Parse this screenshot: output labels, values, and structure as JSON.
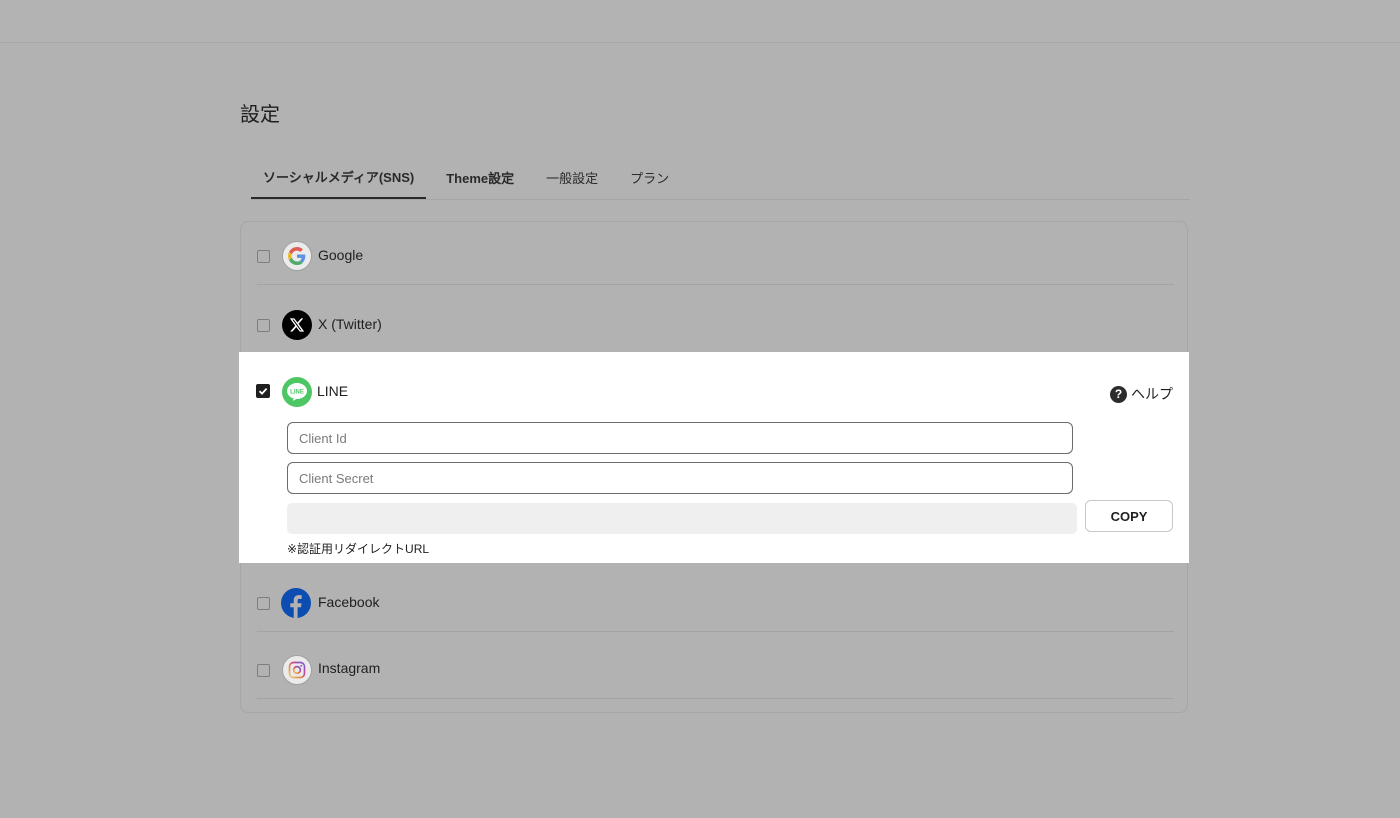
{
  "page": {
    "title": "設定"
  },
  "tabs": [
    {
      "label": "ソーシャルメディア(SNS)",
      "active": true
    },
    {
      "label": "Theme設定",
      "active": false
    },
    {
      "label": "一般設定",
      "active": false
    },
    {
      "label": "プラン",
      "active": false
    }
  ],
  "providers": {
    "google": {
      "label": "Google",
      "checked": false,
      "icon": "google-icon"
    },
    "twitter": {
      "label": "X (Twitter)",
      "checked": false,
      "icon": "x-icon"
    },
    "line": {
      "label": "LINE",
      "checked": true,
      "icon": "line-icon"
    },
    "facebook": {
      "label": "Facebook",
      "checked": false,
      "icon": "facebook-icon"
    },
    "instagram": {
      "label": "Instagram",
      "checked": false,
      "icon": "instagram-icon"
    }
  },
  "line_panel": {
    "help_label": "ヘルプ",
    "client_id_placeholder": "Client Id",
    "client_id_value": "",
    "client_secret_placeholder": "Client Secret",
    "client_secret_value": "",
    "redirect_url_value": "",
    "copy_label": "COPY",
    "redirect_note": "※認証用リダイレクトURL"
  },
  "colors": {
    "line_green": "#4cc764",
    "facebook_blue": "#0866ff",
    "overlay": "#b2b2b2"
  }
}
